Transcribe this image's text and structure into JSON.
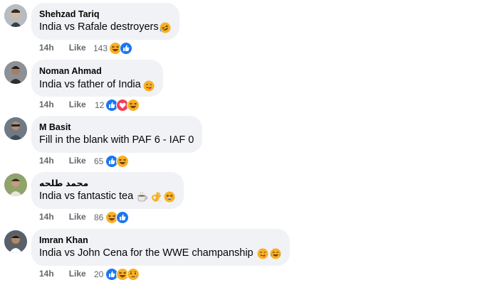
{
  "comments": [
    {
      "author": "Shehzad Tariq",
      "text": "India vs Rafale destroyers",
      "text_emojis": [
        "rolling-laugh"
      ],
      "time": "14h",
      "like_label": "Like",
      "reaction_count": "143",
      "reactions": [
        "haha",
        "like"
      ],
      "avatar_color": "#9aa0a6"
    },
    {
      "author": "Noman Ahmad",
      "text": "India vs father of India",
      "text_emojis": [
        "tongue-wink"
      ],
      "time": "14h",
      "like_label": "Like",
      "reaction_count": "12",
      "reactions": [
        "like",
        "love",
        "haha"
      ],
      "avatar_color": "#6b6f74"
    },
    {
      "author": "M Basit",
      "text": "Fill in the blank with PAF 6 - IAF 0",
      "text_emojis": [],
      "time": "14h",
      "like_label": "Like",
      "reaction_count": "65",
      "reactions": [
        "like",
        "haha"
      ],
      "avatar_color": "#5c6670"
    },
    {
      "author": "محمد طلحه",
      "text": "India vs fantastic tea",
      "text_emojis": [
        "hot-beverage",
        "ok-hand",
        "grinning-squint"
      ],
      "time": "14h",
      "like_label": "Like",
      "reaction_count": "86",
      "reactions": [
        "haha",
        "like"
      ],
      "avatar_color": "#7a8a5a"
    },
    {
      "author": "Imran Khan",
      "text": "India vs John Cena for the WWE champanship",
      "text_emojis": [
        "tongue-wink",
        "tears-of-joy"
      ],
      "time": "14h",
      "like_label": "Like",
      "reaction_count": "20",
      "reactions": [
        "like",
        "haha",
        "sad"
      ],
      "avatar_color": "#4a4f55"
    }
  ],
  "colors": {
    "bubble": "#f0f2f5",
    "meta_text": "#65676b",
    "like_blue": "#1877f2",
    "love_red": "#f33e58",
    "emoji_yellow": "#f7b125"
  }
}
